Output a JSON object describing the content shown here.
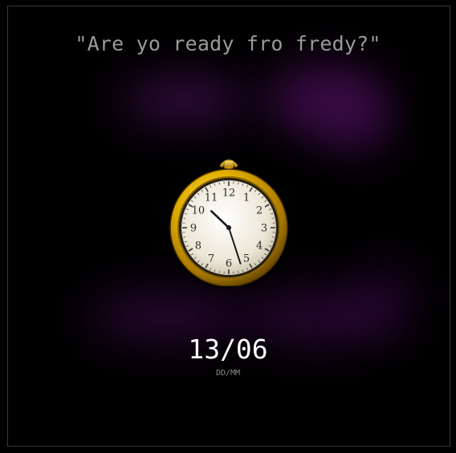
{
  "quote": {
    "text": "\"Are yo ready fro fredy?\""
  },
  "clock": {
    "numerals": [
      "12",
      "1",
      "2",
      "3",
      "4",
      "5",
      "6",
      "7",
      "8",
      "9",
      "10",
      "11"
    ],
    "hour": 10,
    "minute": 27,
    "colors": {
      "case": "#d9a400",
      "face": "#f2ede0"
    }
  },
  "date": {
    "value": "13/06",
    "format": "DD/MM"
  }
}
